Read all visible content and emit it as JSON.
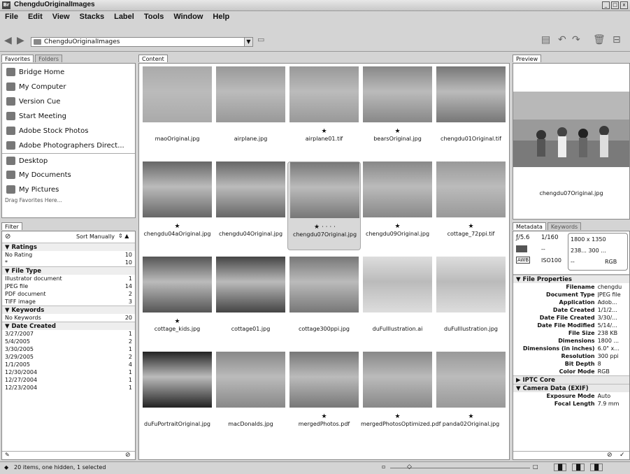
{
  "window": {
    "title": "ChengduOriginalImages",
    "app_icon": "Br"
  },
  "menu": [
    "File",
    "Edit",
    "View",
    "Stacks",
    "Label",
    "Tools",
    "Window",
    "Help"
  ],
  "path": {
    "value": "ChengduOriginalImages"
  },
  "favorites": {
    "tabs": [
      "Favorites",
      "Folders"
    ],
    "items": [
      "Bridge Home",
      "My Computer",
      "Version Cue",
      "Start Meeting",
      "Adobe Stock Photos",
      "Adobe Photographers Direct...",
      "Desktop",
      "My Documents",
      "My Pictures"
    ],
    "hint": "Drag Favorites Here..."
  },
  "filter": {
    "tab": "Filter",
    "sort": "Sort Manually",
    "ratings": {
      "title": "Ratings",
      "rows": [
        {
          "k": "No Rating",
          "v": "10"
        },
        {
          "k": "*",
          "v": "10"
        }
      ]
    },
    "filetype": {
      "title": "File Type",
      "rows": [
        {
          "k": "Illustrator document",
          "v": "1"
        },
        {
          "k": "JPEG file",
          "v": "14"
        },
        {
          "k": "PDF document",
          "v": "2"
        },
        {
          "k": "TIFF image",
          "v": "3"
        }
      ]
    },
    "keywords": {
      "title": "Keywords",
      "rows": [
        {
          "k": "No Keywords",
          "v": "20"
        }
      ]
    },
    "datecreated": {
      "title": "Date Created",
      "rows": [
        {
          "k": "3/27/2007",
          "v": "1"
        },
        {
          "k": "5/4/2005",
          "v": "2"
        },
        {
          "k": "3/30/2005",
          "v": "1"
        },
        {
          "k": "3/29/2005",
          "v": "2"
        },
        {
          "k": "1/1/2005",
          "v": "4"
        },
        {
          "k": "12/30/2004",
          "v": "1"
        },
        {
          "k": "12/27/2004",
          "v": "1"
        },
        {
          "k": "12/23/2004",
          "v": "1"
        }
      ]
    }
  },
  "content": {
    "tab": "Content",
    "items": [
      {
        "name": "maoOriginal.jpg",
        "star": ""
      },
      {
        "name": "airplane.jpg",
        "star": ""
      },
      {
        "name": "airplane01.tif",
        "star": "★"
      },
      {
        "name": "bearsOriginal.jpg",
        "star": "★"
      },
      {
        "name": "chengdu01Original.tif",
        "star": ""
      },
      {
        "name": "chengdu04aOriginal.jpg",
        "star": "★"
      },
      {
        "name": "chengdu04Original.jpg",
        "star": ""
      },
      {
        "name": "chengdu07Original.jpg",
        "star": "★ · · · ·"
      },
      {
        "name": "chengdu09Original.jpg",
        "star": "★"
      },
      {
        "name": "cottage_72ppi.tif",
        "star": "★"
      },
      {
        "name": "cottage_kids.jpg",
        "star": "★"
      },
      {
        "name": "cottage01.jpg",
        "star": ""
      },
      {
        "name": "cottage300ppi.jpg",
        "star": ""
      },
      {
        "name": "duFuIllustration.ai",
        "star": ""
      },
      {
        "name": "duFuIllustration.jpg",
        "star": ""
      },
      {
        "name": "duFuPortraitOriginal.jpg",
        "star": ""
      },
      {
        "name": "macDonalds.jpg",
        "star": ""
      },
      {
        "name": "mergedPhotos.pdf",
        "star": "★"
      },
      {
        "name": "mergedPhotosOptimized.pdf",
        "star": "★"
      },
      {
        "name": "panda02Original.jpg",
        "star": "★"
      }
    ]
  },
  "preview": {
    "tab": "Preview",
    "caption": "chengdu07Original.jpg"
  },
  "metadata": {
    "tabs": [
      "Metadata",
      "Keywords"
    ],
    "camera": {
      "fstop": "ƒ/5.6",
      "shutter": "1/160",
      "wb": "AWB",
      "iso": "ISO100",
      "dash1": "--",
      "dash2": "--",
      "dim": "1800 x 1350",
      "size": "238... 300 ...",
      "mode": "RGB"
    },
    "file_props_title": "File Properties",
    "file_props": [
      {
        "k": "Filename",
        "v": "chengdu"
      },
      {
        "k": "Document Type",
        "v": "JPEG file"
      },
      {
        "k": "Application",
        "v": "Adob..."
      },
      {
        "k": "Date Created",
        "v": "1/1/2..."
      },
      {
        "k": "Date File Created",
        "v": "3/30/..."
      },
      {
        "k": "Date File Modified",
        "v": "5/14/..."
      },
      {
        "k": "File Size",
        "v": "238 KB"
      },
      {
        "k": "Dimensions",
        "v": "1800 ..."
      },
      {
        "k": "Dimensions (in inches)",
        "v": "6.0\" x..."
      },
      {
        "k": "Resolution",
        "v": "300 ppi"
      },
      {
        "k": "Bit Depth",
        "v": "8"
      },
      {
        "k": "Color Mode",
        "v": "RGB"
      }
    ],
    "iptc_title": "IPTC Core",
    "exif_title": "Camera Data (EXIF)",
    "exif": [
      {
        "k": "Exposure Mode",
        "v": "Auto"
      },
      {
        "k": "Focal Length",
        "v": "7.9 mm"
      }
    ]
  },
  "status": {
    "text": "20 items, one hidden, 1 selected",
    "views": [
      "▐▌",
      "▐▌",
      "▐▌"
    ]
  }
}
